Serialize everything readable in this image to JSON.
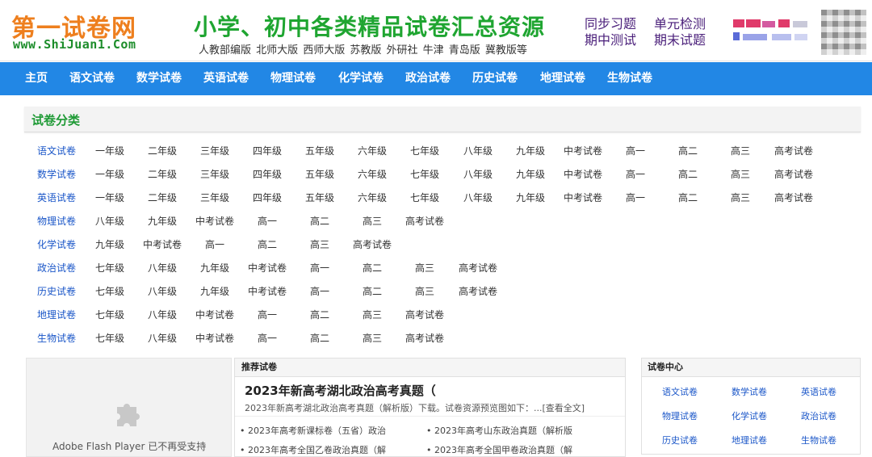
{
  "header": {
    "logo_cn": "第一试卷网",
    "logo_en": "www.ShiJuan1.Com",
    "slogan": "小学、初中各类精品试卷汇总资源",
    "versions": "人教部编版 北师大版 西师大版 苏教版 外研社 牛津 青岛版 冀教版等",
    "quick_links": [
      "同步习题",
      "单元检测",
      "期中测试",
      "期末试题"
    ]
  },
  "nav": [
    "主页",
    "语文试卷",
    "数学试卷",
    "英语试卷",
    "物理试卷",
    "化学试卷",
    "政治试卷",
    "历史试卷",
    "地理试卷",
    "生物试卷"
  ],
  "category": {
    "title": "试卷分类",
    "rows": [
      {
        "subject": "语文试卷",
        "grades": [
          "一年级",
          "二年级",
          "三年级",
          "四年级",
          "五年级",
          "六年级",
          "七年级",
          "八年级",
          "九年级",
          "中考试卷",
          "高一",
          "高二",
          "高三",
          "高考试卷"
        ]
      },
      {
        "subject": "数学试卷",
        "grades": [
          "一年级",
          "二年级",
          "三年级",
          "四年级",
          "五年级",
          "六年级",
          "七年级",
          "八年级",
          "九年级",
          "中考试卷",
          "高一",
          "高二",
          "高三",
          "高考试卷"
        ]
      },
      {
        "subject": "英语试卷",
        "grades": [
          "一年级",
          "二年级",
          "三年级",
          "四年级",
          "五年级",
          "六年级",
          "七年级",
          "八年级",
          "九年级",
          "中考试卷",
          "高一",
          "高二",
          "高三",
          "高考试卷"
        ]
      },
      {
        "subject": "物理试卷",
        "grades": [
          "八年级",
          "九年级",
          "中考试卷",
          "高一",
          "高二",
          "高三",
          "高考试卷"
        ]
      },
      {
        "subject": "化学试卷",
        "grades": [
          "九年级",
          "中考试卷",
          "高一",
          "高二",
          "高三",
          "高考试卷"
        ]
      },
      {
        "subject": "政治试卷",
        "grades": [
          "七年级",
          "八年级",
          "九年级",
          "中考试卷",
          "高一",
          "高二",
          "高三",
          "高考试卷"
        ]
      },
      {
        "subject": "历史试卷",
        "grades": [
          "七年级",
          "八年级",
          "九年级",
          "中考试卷",
          "高一",
          "高二",
          "高三",
          "高考试卷"
        ]
      },
      {
        "subject": "地理试卷",
        "grades": [
          "七年级",
          "八年级",
          "中考试卷",
          "高一",
          "高二",
          "高三",
          "高考试卷"
        ]
      },
      {
        "subject": "生物试卷",
        "grades": [
          "七年级",
          "八年级",
          "中考试卷",
          "高一",
          "高二",
          "高三",
          "高考试卷"
        ]
      }
    ]
  },
  "flash": {
    "icon": "puzzle-plugin-icon",
    "text": "Adobe Flash Player 已不再受支持"
  },
  "recommend": {
    "header": "推荐试卷",
    "title": "2023年新高考湖北政治高考真题（",
    "desc": "2023年新高考湖北政治高考真题（解析版）下载。试卷资源预览图如下：...[查看全文]",
    "items": [
      "• 2023年高考新课标卷（五省）政治",
      "• 2023年高考山东政治真题（解析版",
      "• 2023年高考全国乙卷政治真题（解",
      "• 2023年高考全国甲卷政治真题（解"
    ]
  },
  "center": {
    "header": "试卷中心",
    "links": [
      "语文试卷",
      "数学试卷",
      "英语试卷",
      "物理试卷",
      "化学试卷",
      "政治试卷",
      "历史试卷",
      "地理试卷",
      "生物试卷"
    ]
  },
  "colors": {
    "nav_bg": "#2287e5",
    "brand_green": "#1fa531",
    "brand_orange": "#ee7f1e",
    "link_blue": "#1a56c8"
  }
}
